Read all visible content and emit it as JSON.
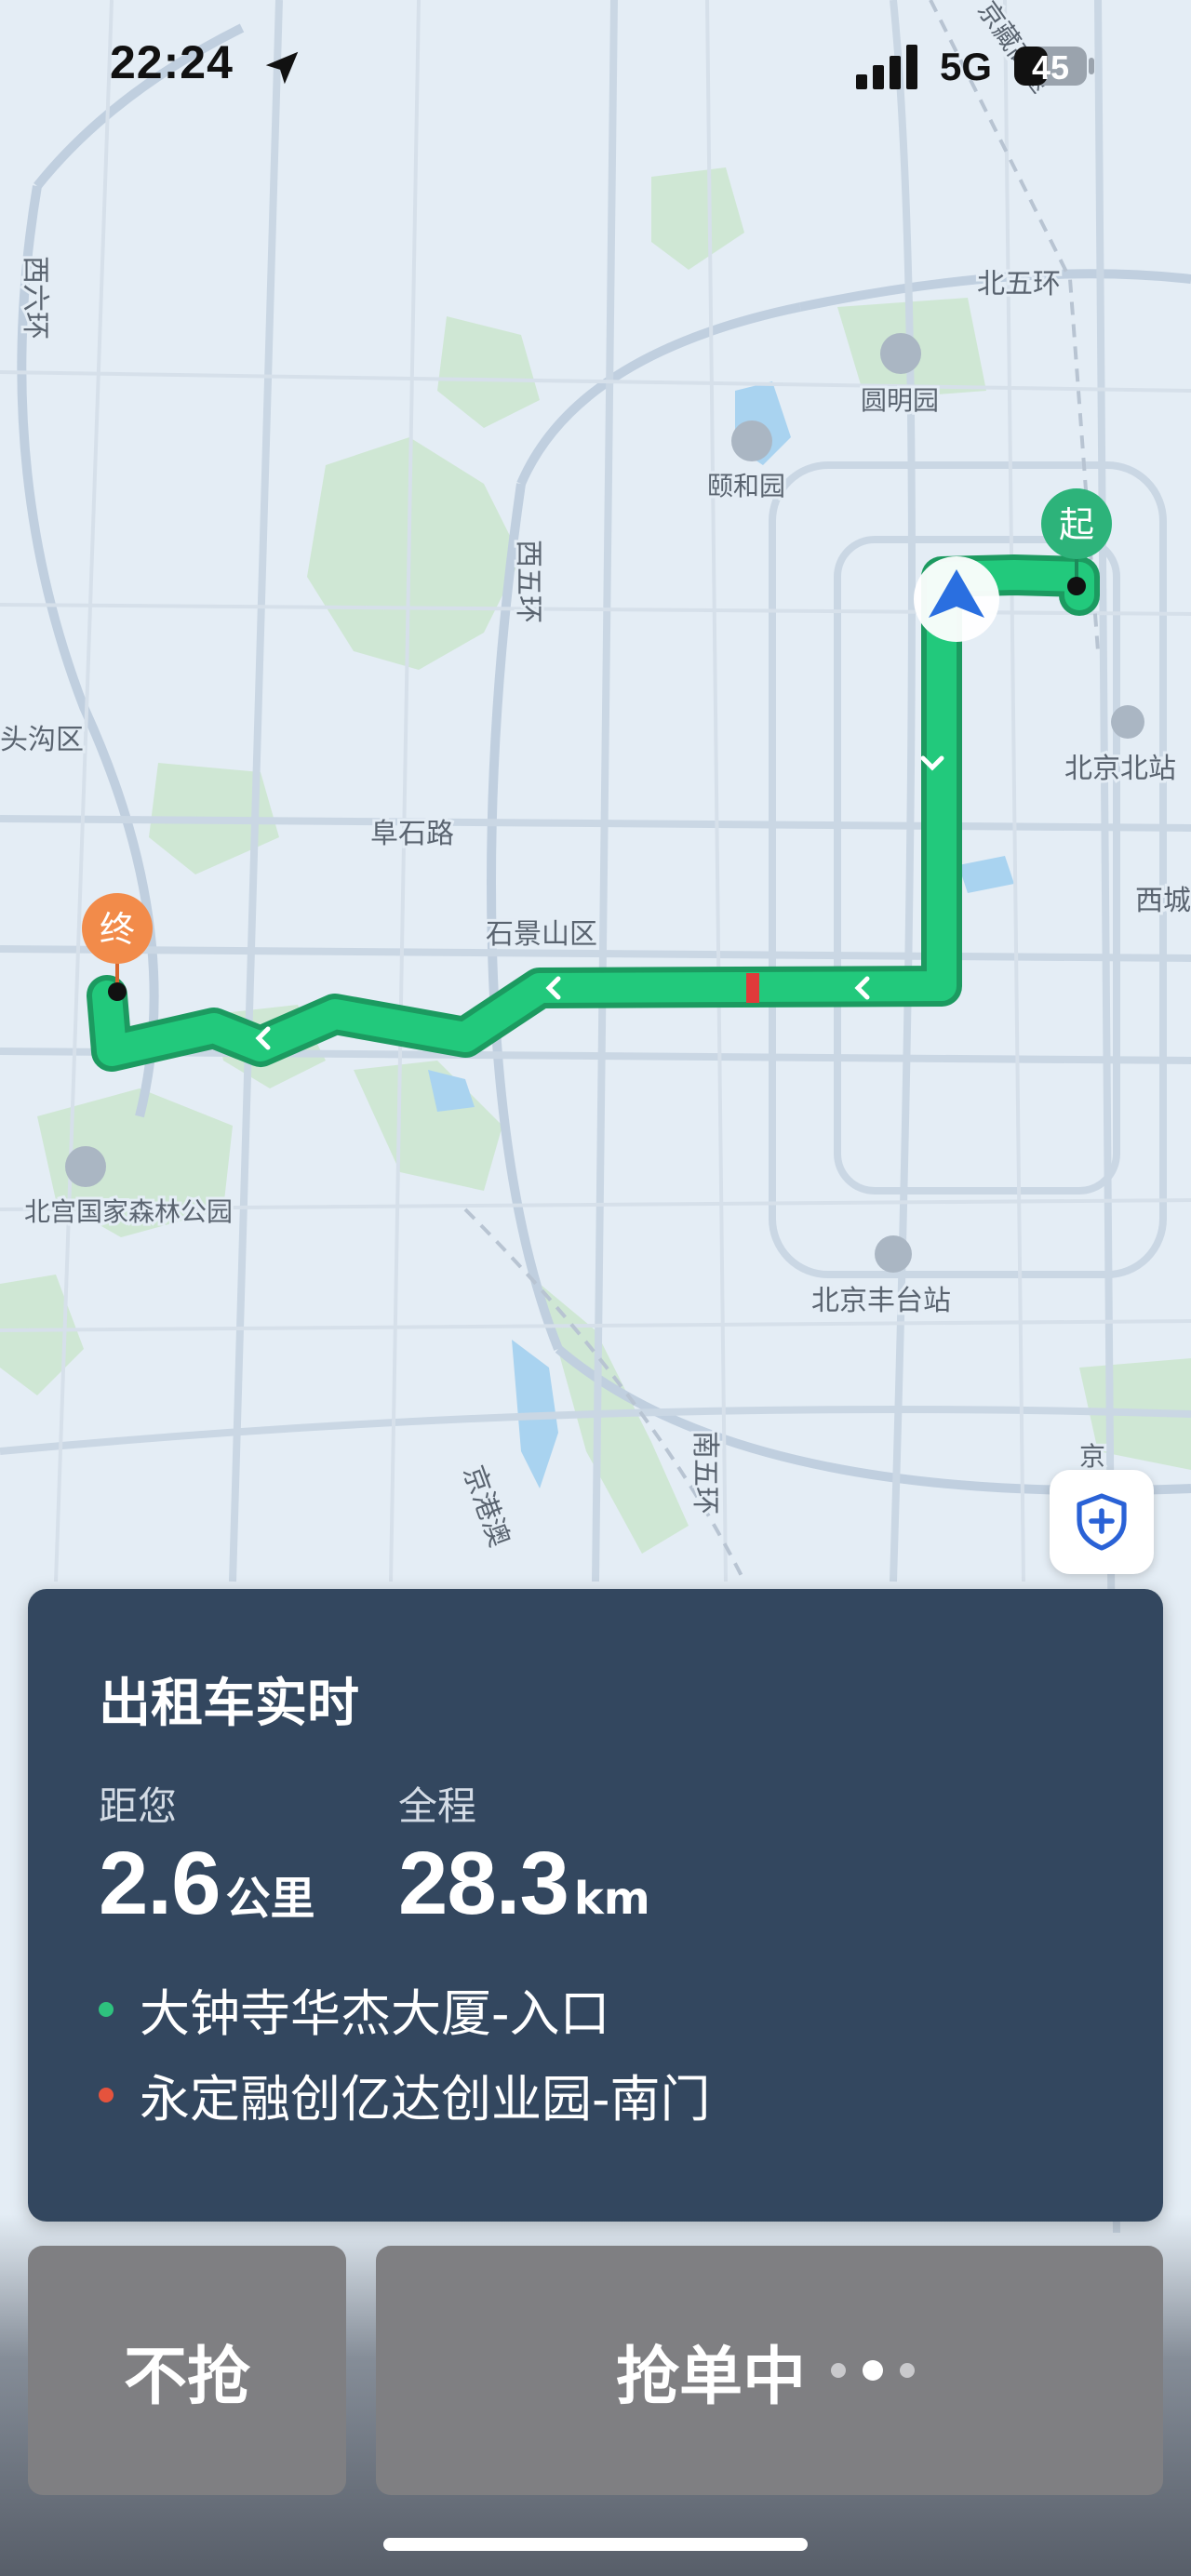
{
  "status_bar": {
    "time": "22:24",
    "network": "5G",
    "battery": "45"
  },
  "map": {
    "labels": [
      "北五环",
      "圆明园",
      "颐和园",
      "西六环",
      "西五环",
      "头沟区",
      "阜石路",
      "石景山区",
      "北京北站",
      "西城",
      "北宫国家森林公园",
      "北京丰台站",
      "南五环",
      "京港澳",
      "京藏高速",
      "京"
    ],
    "start_marker": "起",
    "end_marker": "终",
    "route_color": "#1fc37a",
    "congestion_color": "#e03a3a"
  },
  "order_card": {
    "title": "出租车实时",
    "distance_label": "距您",
    "distance_value": "2.6",
    "distance_unit": "公里",
    "total_label": "全程",
    "total_value": "28.3",
    "total_unit": "km",
    "pickup": "大钟寺华杰大厦-入口",
    "dropoff": "永定融创亿达创业园-南门",
    "pickup_color": "#2ec27e",
    "dropoff_color": "#e5533d"
  },
  "actions": {
    "skip_label": "不抢",
    "grab_label": "抢单中"
  },
  "icons": {
    "safety": "shield-plus-icon",
    "location": "location-arrow-icon",
    "navigation": "navigation-arrow-icon"
  }
}
